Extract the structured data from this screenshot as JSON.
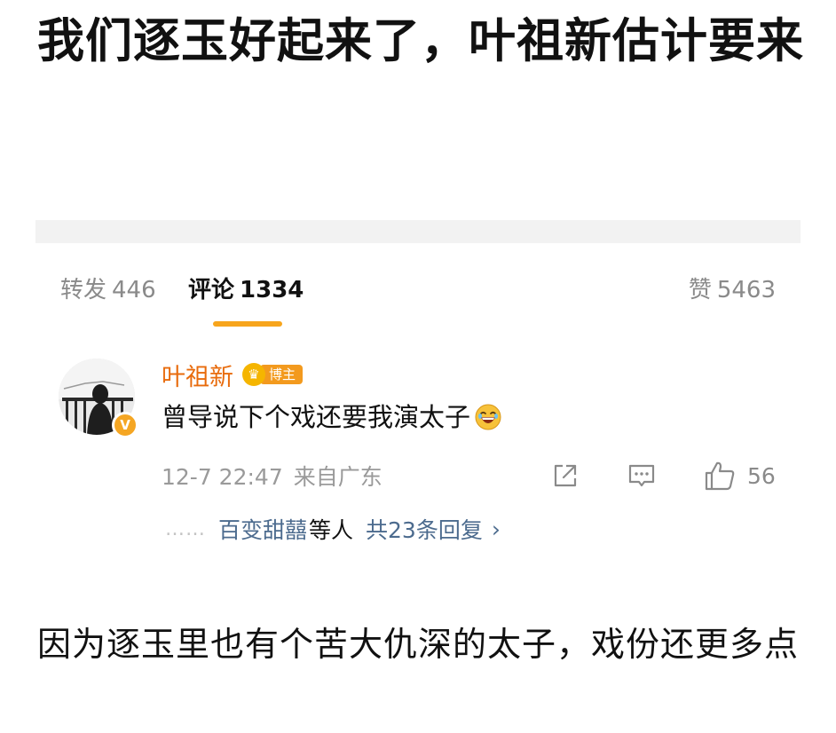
{
  "post": {
    "headline": "我们逐玉好起来了，叶祖新估计要来"
  },
  "tabs": {
    "forward": {
      "label": "转发",
      "count": "446"
    },
    "comments": {
      "label": "评论",
      "count": "1334"
    },
    "likes": {
      "label": "赞",
      "count": "5463"
    }
  },
  "comment": {
    "username": "叶祖新",
    "badge_label": "博主",
    "verified_mark": "V",
    "text": "曾导说下个戏还要我演太子",
    "date": "12-7 22:47",
    "location": "来自广东",
    "like_count": "56",
    "reply_users": "百变甜囍",
    "reply_suffix": "等人",
    "reply_total": "共23条回复",
    "dots": "……"
  },
  "footer": {
    "text": "因为逐玉里也有个苦大仇深的太子，戏份还更多点"
  },
  "colors": {
    "accent": "#f7a51c",
    "username": "#e86b0c",
    "link": "#4c6b8e",
    "muted": "#9a9a9a"
  },
  "icons": {
    "share": "share-icon",
    "comment": "comment-icon",
    "like": "thumbs-up-icon",
    "chevron": "chevron-right-icon",
    "emoji": "laughing-emoji-icon"
  }
}
